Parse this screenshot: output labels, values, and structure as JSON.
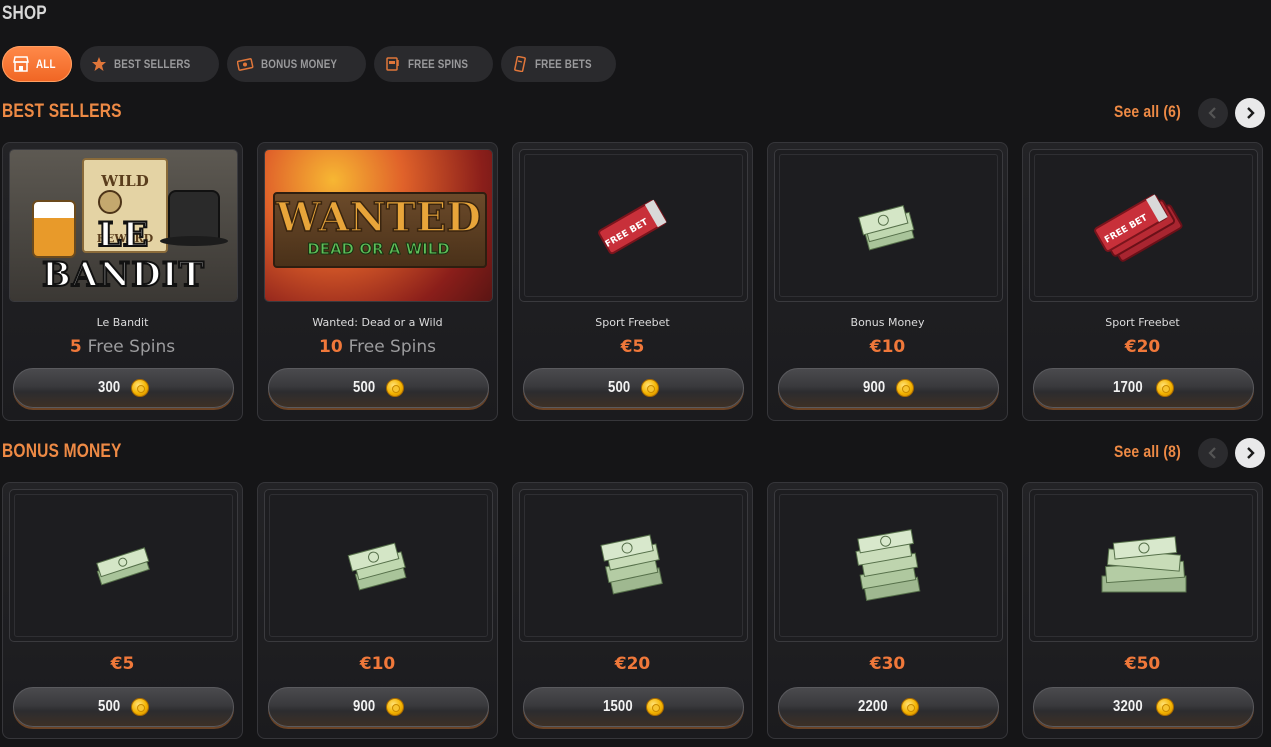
{
  "page": {
    "title": "SHOP"
  },
  "filters": [
    {
      "label": "ALL",
      "icon": "store-icon",
      "active": true
    },
    {
      "label": "BEST SELLERS",
      "icon": "star-icon",
      "active": false
    },
    {
      "label": "BONUS MONEY",
      "icon": "cash-icon",
      "active": false
    },
    {
      "label": "FREE SPINS",
      "icon": "slot-machine-icon",
      "active": false
    },
    {
      "label": "FREE BETS",
      "icon": "ticket-icon",
      "active": false
    }
  ],
  "best_sellers": {
    "title": "BEST SELLERS",
    "see_all": "See all (6)",
    "items": [
      {
        "name": "Le Bandit",
        "amount": "5",
        "unit": "Free Spins",
        "price": "300",
        "image": "le-bandit-game-art",
        "art_text": {
          "top": "WILD",
          "middle": "REWARD",
          "bottom": "LE BANDIT"
        }
      },
      {
        "name": "Wanted: Dead or a Wild",
        "amount": "10",
        "unit": "Free Spins",
        "price": "500",
        "image": "wanted-game-art",
        "art_text": {
          "top": "WANTED",
          "bottom": "DEAD OR A WILD"
        }
      },
      {
        "name": "Sport Freebet",
        "amount": "€5",
        "unit": "",
        "price": "500",
        "image": "free-bet-ticket"
      },
      {
        "name": "Bonus Money",
        "amount": "€10",
        "unit": "",
        "price": "900",
        "image": "cash-stack"
      },
      {
        "name": "Sport Freebet",
        "amount": "€20",
        "unit": "",
        "price": "1700",
        "image": "free-bet-tickets"
      }
    ]
  },
  "bonus_money": {
    "title": "BONUS MONEY",
    "see_all": "See all (8)",
    "items": [
      {
        "amount": "€5",
        "price": "500",
        "image": "cash-stack-small"
      },
      {
        "amount": "€10",
        "price": "900",
        "image": "cash-stack"
      },
      {
        "amount": "€20",
        "price": "1500",
        "image": "cash-stack-medium"
      },
      {
        "amount": "€30",
        "price": "2200",
        "image": "cash-stack-large"
      },
      {
        "amount": "€50",
        "price": "3200",
        "image": "cash-pile"
      }
    ]
  },
  "ticket_label": "FREE BET",
  "colors": {
    "accent": "#f06523",
    "section_title": "#ee8a45",
    "background": "#151517"
  }
}
